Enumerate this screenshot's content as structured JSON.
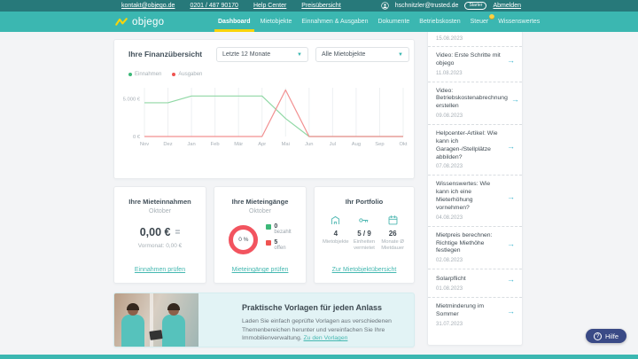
{
  "colors": {
    "topbar": "#27797a",
    "nav": "#3bb7b1",
    "accent_yellow": "#f8d40a",
    "link_teal": "#45b8b1",
    "donut_red": "#f2545f",
    "paid_green": "#3cb878",
    "open_red": "#ef5350",
    "help_navy": "#3a4a86"
  },
  "topbar": {
    "links": [
      "kontakt@objego.de",
      "0201 / 487 90170",
      "Help Center",
      "Preisübersicht"
    ],
    "user_email": "hschnitzler@trusted.de",
    "plan_badge": "Starter",
    "logout_label": "Abmelden"
  },
  "nav": {
    "brand": "objego",
    "tabs": [
      {
        "label": "Dashboard",
        "active": true,
        "badge": false
      },
      {
        "label": "Mietobjekte",
        "active": false,
        "badge": false
      },
      {
        "label": "Einnahmen & Ausgaben",
        "active": false,
        "badge": false
      },
      {
        "label": "Dokumente",
        "active": false,
        "badge": false
      },
      {
        "label": "Betriebskosten",
        "active": false,
        "badge": false
      },
      {
        "label": "Steuer",
        "active": false,
        "badge": true
      },
      {
        "label": "Wissenswertes",
        "active": false,
        "badge": false
      }
    ]
  },
  "finance_overview": {
    "title": "Ihre Finanzübersicht",
    "period_filter": "Letzte 12 Monate",
    "property_filter": "Alle Mietobjekte",
    "legend": [
      {
        "label": "Einnahmen",
        "color": "#3cb878"
      },
      {
        "label": "Ausgaben",
        "color": "#ef5350"
      }
    ]
  },
  "chart_data": {
    "type": "line",
    "title": "Ihre Finanzübersicht",
    "x": [
      "Nov",
      "Dez",
      "Jan",
      "Feb",
      "Mär",
      "Apr",
      "Mai",
      "Jun",
      "Jul",
      "Aug",
      "Sep",
      "Okt"
    ],
    "series": [
      {
        "name": "Einnahmen",
        "color": "#90d8a5",
        "values": [
          4500,
          4500,
          5400,
          5400,
          5400,
          5400,
          2400,
          0,
          0,
          0,
          0,
          0
        ]
      },
      {
        "name": "Ausgaben",
        "color": "#f29091",
        "values": [
          0,
          0,
          0,
          0,
          0,
          0,
          6200,
          0,
          0,
          0,
          0,
          0
        ]
      }
    ],
    "ylim": [
      0,
      6500
    ],
    "yticks": [
      {
        "value": 5000,
        "label": "5.000 €"
      },
      {
        "value": 0,
        "label": "0 €"
      }
    ],
    "grid": "vertical",
    "legend_position": "top-left"
  },
  "cards": {
    "rent_income": {
      "title": "Ihre Mieteinnahmen",
      "month": "Oktober",
      "amount": "0,00 €",
      "trend_icon": "=",
      "previous_label": "Vormonat:",
      "previous_value": "0,00 €",
      "link": "Einnahmen prüfen"
    },
    "rent_receipts": {
      "title": "Ihre Mieteingänge",
      "month": "Oktober",
      "percent": "0 %",
      "paid_count": "0",
      "paid_label": "bezahlt",
      "open_count": "5",
      "open_label": "offen",
      "link": "Mieteingänge prüfen"
    },
    "portfolio": {
      "title": "Ihr Portfolio",
      "stats": [
        {
          "icon": "building-icon",
          "value": "4",
          "label": "Mietobjekte"
        },
        {
          "icon": "key-icon",
          "value": "5 / 9",
          "label": "Einheiten vermietet"
        },
        {
          "icon": "calendar-icon",
          "value": "26",
          "label": "Monate Ø Mietdauer"
        }
      ],
      "link": "Zur Mietobjektübersicht"
    }
  },
  "banner": {
    "title": "Praktische Vorlagen für jeden Anlass",
    "text": "Laden Sie einfach geprüfte Vorlagen aus verschiedenen Themenbereichen herunter und vereinfachen Sie Ihre Immobilienverwaltung.",
    "link": "Zu den Vorlagen"
  },
  "sidebar": {
    "items": [
      {
        "title": "",
        "date": "15.08.2023"
      },
      {
        "title": "Video: Erste Schritte mit objego",
        "date": "11.08.2023"
      },
      {
        "title": "Video: Betriebskostenabrechnung erstellen",
        "date": "09.08.2023"
      },
      {
        "title": "Helpcenter-Artikel: Wie kann ich Garagen-/Stellplätze abbilden?",
        "date": "07.08.2023"
      },
      {
        "title": "Wissenswertes: Wie kann ich eine Mieterhöhung vornehmen?",
        "date": "04.08.2023"
      },
      {
        "title": "Mietpreis berechnen: Richtige Miethöhe festlegen",
        "date": "02.08.2023"
      },
      {
        "title": "Solarpflicht",
        "date": "01.08.2023"
      },
      {
        "title": "Mietminderung im Sommer",
        "date": "31.07.2023"
      }
    ]
  },
  "help_button": {
    "label": "Hilfe"
  }
}
